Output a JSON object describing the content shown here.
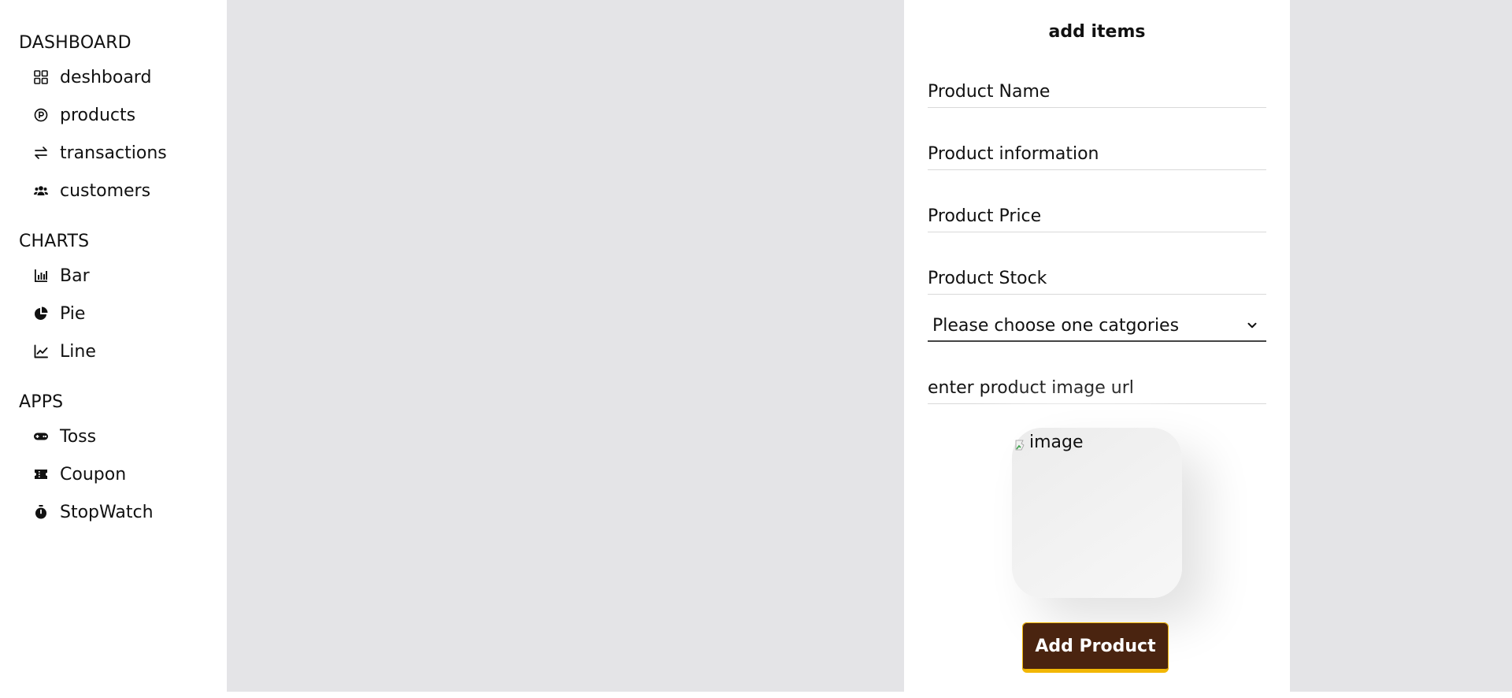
{
  "sidebar": {
    "sections": [
      {
        "title": "DASHBOARD",
        "items": [
          {
            "label": "deshboard",
            "icon": "grid-icon"
          },
          {
            "label": "products",
            "icon": "product-icon"
          },
          {
            "label": "transactions",
            "icon": "swap-icon"
          },
          {
            "label": "customers",
            "icon": "users-icon"
          }
        ]
      },
      {
        "title": "CHARTS",
        "items": [
          {
            "label": "Bar",
            "icon": "bar-chart-icon"
          },
          {
            "label": "Pie",
            "icon": "pie-chart-icon"
          },
          {
            "label": "Line",
            "icon": "line-chart-icon"
          }
        ]
      },
      {
        "title": "APPS",
        "items": [
          {
            "label": "Toss",
            "icon": "gamepad-icon"
          },
          {
            "label": "Coupon",
            "icon": "ticket-icon"
          },
          {
            "label": "StopWatch",
            "icon": "stopwatch-icon"
          }
        ]
      }
    ]
  },
  "form": {
    "title": "add items",
    "product_name": {
      "placeholder": "Product Name",
      "value": ""
    },
    "product_information": {
      "placeholder": "Product information",
      "value": ""
    },
    "product_price": {
      "placeholder": "Product Price",
      "value": ""
    },
    "product_stock": {
      "placeholder": "Product Stock",
      "value": ""
    },
    "category": {
      "selected": "Please choose one catgories"
    },
    "image_url": {
      "placeholder": "enter product image url",
      "value": ""
    },
    "image_preview": {
      "alt": "image"
    },
    "submit_label": "Add Product"
  },
  "colors": {
    "main_bg": "#e4e4e7",
    "button_bg": "#4a2410",
    "button_accent": "#f2b705"
  }
}
